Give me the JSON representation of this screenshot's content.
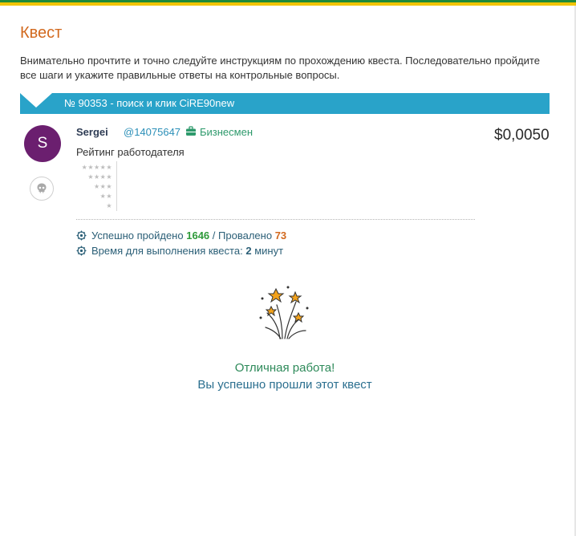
{
  "page": {
    "title": "Квест",
    "intro": "Внимательно прочтите и точно следуйте инструкциям по прохождению квеста. Последовательно пройдите все шаги и укажите правильные ответы на контрольные вопросы."
  },
  "quest": {
    "title": "№ 90353 - поиск и клик CiRE90new",
    "price": "$0,0050"
  },
  "user": {
    "avatar_letter": "S",
    "name": "Sergei",
    "id": "@14075647",
    "role": "Бизнесмен",
    "rating_label": "Рейтинг работодателя",
    "rating_rows": [
      "★★★★★",
      "★★★★",
      "★★★",
      "★★",
      "★"
    ]
  },
  "stats": {
    "success_label": "Успешно пройдено",
    "success_count": "1646",
    "sep": "/",
    "failed_label": "Провалено",
    "failed_count": "73",
    "time_label": "Время для выполнения квеста:",
    "time_value": "2",
    "time_unit": "минут"
  },
  "result": {
    "line1": "Отличная работа!",
    "line2": "Вы успешно прошли этот квест"
  },
  "colors": {
    "accent_orange": "#d2691e",
    "band_blue": "#29a3c9",
    "avatar_purple": "#6b1f6f",
    "success_green": "#2e9a3a"
  },
  "icons": [
    "briefcase-icon",
    "skull-icon",
    "gear-icon",
    "fireworks-icon"
  ]
}
